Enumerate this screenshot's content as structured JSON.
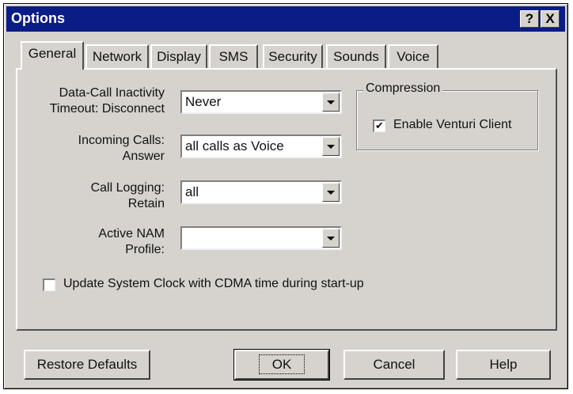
{
  "window": {
    "title": "Options",
    "help_button": "?",
    "close_button": "X"
  },
  "tabs": [
    {
      "label": "General",
      "active": true
    },
    {
      "label": "Network",
      "active": false
    },
    {
      "label": "Display",
      "active": false
    },
    {
      "label": "SMS",
      "active": false
    },
    {
      "label": "Security",
      "active": false
    },
    {
      "label": "Sounds",
      "active": false
    },
    {
      "label": "Voice",
      "active": false
    }
  ],
  "general": {
    "data_call": {
      "label_line1": "Data-Call Inactivity",
      "label_line2": "Timeout: Disconnect",
      "value": "Never"
    },
    "incoming_calls": {
      "label_line1": "Incoming Calls:",
      "label_line2": "Answer",
      "value": "all calls as Voice"
    },
    "call_logging": {
      "label_line1": "Call Logging:",
      "label_line2": "Retain",
      "value": "all"
    },
    "active_nam": {
      "label_line1": "Active NAM",
      "label_line2": "Profile:",
      "value": ""
    },
    "compression": {
      "legend": "Compression",
      "enable_label": "Enable Venturi Client",
      "enable_checked": true
    },
    "update_clock": {
      "label": "Update System Clock with CDMA time during start-up",
      "checked": false
    }
  },
  "buttons": {
    "restore": "Restore Defaults",
    "ok": "OK",
    "cancel": "Cancel",
    "help": "Help"
  },
  "colors": {
    "titlebar": "#0a1c86",
    "face": "#d6d3ce"
  }
}
